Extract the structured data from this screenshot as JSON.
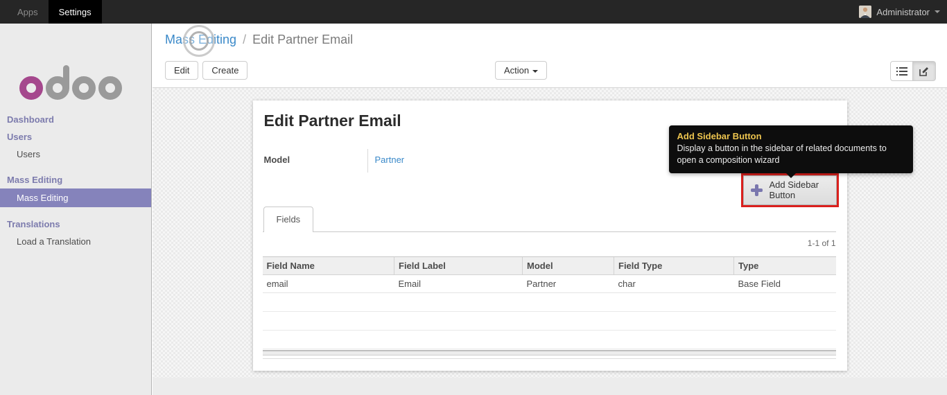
{
  "topbar": {
    "apps_label": "Apps",
    "settings_label": "Settings",
    "user_name": "Administrator"
  },
  "sidebar": {
    "items": [
      {
        "label": "Dashboard",
        "type": "heading"
      },
      {
        "label": "Users",
        "type": "heading"
      },
      {
        "label": "Users",
        "type": "item"
      },
      {
        "label": "Mass Editing",
        "type": "heading"
      },
      {
        "label": "Mass Editing",
        "type": "item",
        "selected": true
      },
      {
        "label": "Translations",
        "type": "heading"
      },
      {
        "label": "Load a Translation",
        "type": "item"
      }
    ]
  },
  "control_panel": {
    "breadcrumb_parent": "Mass Editing",
    "breadcrumb_separator": "/",
    "breadcrumb_current": "Edit Partner Email",
    "edit_button": "Edit",
    "create_button": "Create",
    "action_button": "Action"
  },
  "form": {
    "title": "Edit Partner Email",
    "model_label": "Model",
    "model_value": "Partner",
    "add_sidebar_button_label": "Add Sidebar Button",
    "tab_fields": "Fields",
    "pager": "1-1 of 1"
  },
  "tooltip": {
    "title": "Add Sidebar Button",
    "body": "Display a button in the sidebar of related documents to open a composition wizard"
  },
  "fields_table": {
    "headers": [
      "Field Name",
      "Field Label",
      "Model",
      "Field Type",
      "Type"
    ],
    "rows": [
      [
        "email",
        "Email",
        "Partner",
        "char",
        "Base Field"
      ]
    ]
  },
  "colors": {
    "brand_purple": "#7c7bad",
    "selected_purple": "#8583bb",
    "link_blue": "#3a89c9",
    "tooltip_title_yellow": "#eec54f",
    "annotation_red": "#da1f1c",
    "logo_magenta": "#a5488d"
  }
}
